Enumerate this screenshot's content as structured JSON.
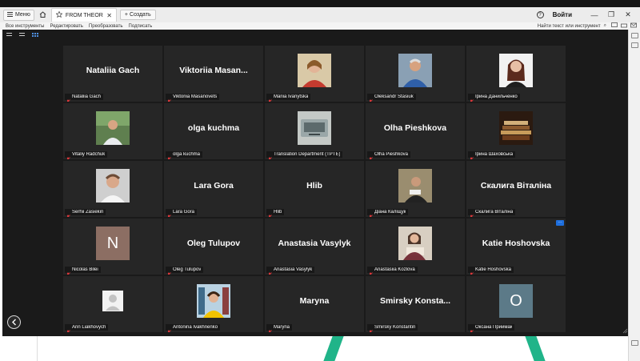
{
  "tabbar": {
    "menu_label": "Меню",
    "tab_title": "FROM THEORY TO ...",
    "tab_close": "✕",
    "create_label": "Создать",
    "login_label": "Войти",
    "help_glyph": "?",
    "window_buttons": [
      "—",
      "❐",
      "✕"
    ]
  },
  "toolbar": {
    "items": [
      "Все инструменты",
      "Редактировать",
      "Преобразовать",
      "Подписать"
    ],
    "find_label": "Найти текст или инструмент",
    "search_glyph": "⌕"
  },
  "colors": {
    "accent": "#1e6fde",
    "mic_muted": "#e0383b",
    "tile_bg": "#262626",
    "stage_bg": "#1a1a1a",
    "green_stripe": "#20b489"
  },
  "participants": [
    {
      "display": "Nataliia Gach",
      "label": "Nataliia Gach",
      "type": "name"
    },
    {
      "display": "Viktoriia  Masan...",
      "label": "Viktoriia Masanovets",
      "type": "name"
    },
    {
      "display": "",
      "label": "Mariia Ivanytska",
      "type": "photo",
      "photo_icon": "woman-red-top-photo"
    },
    {
      "display": "",
      "label": "Oleksandr Stasiuk",
      "type": "photo",
      "photo_icon": "man-blue-shirt-photo"
    },
    {
      "display": "",
      "label": "Ірина Данильченко",
      "type": "photo",
      "photo_icon": "woman-portrait-photo"
    },
    {
      "display": "",
      "label": "Vitaliy Radchuk",
      "type": "photo",
      "photo_icon": "man-outdoors-photo"
    },
    {
      "display": "olga kuchma",
      "label": "olga kuchma",
      "type": "name"
    },
    {
      "display": "",
      "label": "Translation Department (TPTE)",
      "type": "photo",
      "photo_icon": "device-photo"
    },
    {
      "display": "Olha Pieshkova",
      "label": "Olha Pieshkova",
      "type": "name"
    },
    {
      "display": "",
      "label": "Ірина Шаховська",
      "type": "photo",
      "photo_icon": "books-photo"
    },
    {
      "display": "",
      "label": "Serhii Zasiekin",
      "type": "photo",
      "photo_icon": "man-portrait-photo"
    },
    {
      "display": "Lara Gora",
      "label": "Lara Gora",
      "type": "name"
    },
    {
      "display": "Hlib",
      "label": "Hlib",
      "type": "name"
    },
    {
      "display": "",
      "label": "Діана Каліщук",
      "type": "photo",
      "photo_icon": "person-reading-photo"
    },
    {
      "display": "Скалига Віталіна",
      "label": "Скалига Віталіна",
      "type": "name"
    },
    {
      "display": "N",
      "label": "Nicolas Bilei",
      "type": "initial",
      "initial_color": "#8c6e63"
    },
    {
      "display": "Oleg Tulupov",
      "label": "Oleg Tulupov",
      "type": "name"
    },
    {
      "display": "Anastasia Vasylyk",
      "label": "Anastasia Vasylyk",
      "type": "name"
    },
    {
      "display": "",
      "label": "Anastasiia Kozlova",
      "type": "photo",
      "photo_icon": "woman-reading-photo"
    },
    {
      "display": "Katie Hoshovska",
      "label": "Katie Hoshovska",
      "type": "name",
      "more": "···"
    },
    {
      "display": "",
      "label": "Ann Liakhovych",
      "type": "photo",
      "photo_icon": "default-avatar"
    },
    {
      "display": "",
      "label": "Antonina Ivakhnenko",
      "type": "photo",
      "photo_icon": "woman-library-photo"
    },
    {
      "display": "Maryna",
      "label": "Maryna",
      "type": "name"
    },
    {
      "display": "Smirsky  Konsta...",
      "label": "Smirsky Konstantin",
      "type": "name"
    },
    {
      "display": "O",
      "label": "Оксана Приймак",
      "type": "initial",
      "initial_color": "#5c7a88"
    }
  ]
}
